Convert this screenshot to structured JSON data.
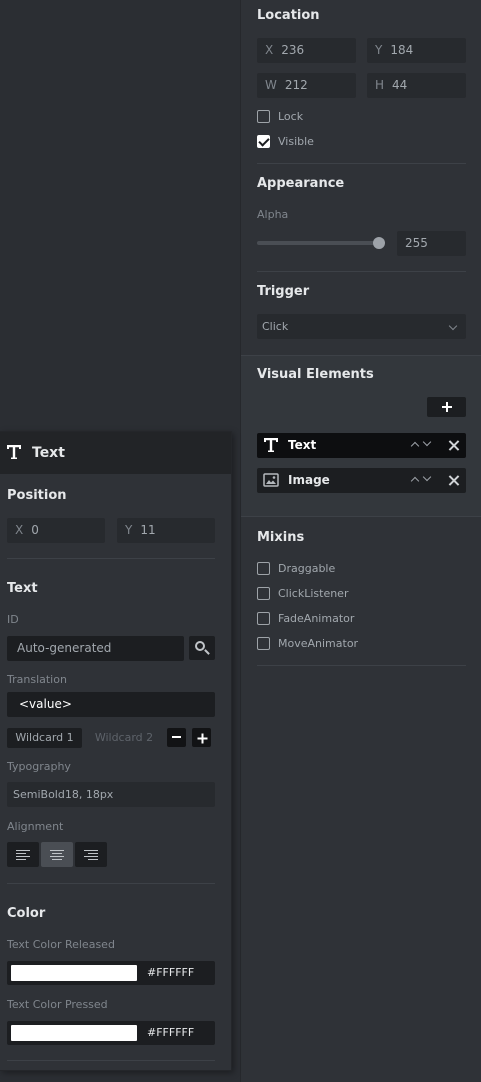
{
  "location": {
    "title": "Location",
    "x_label": "X",
    "x_value": "236",
    "y_label": "Y",
    "y_value": "184",
    "w_label": "W",
    "w_value": "212",
    "h_label": "H",
    "h_value": "44",
    "lock_label": "Lock",
    "lock_checked": false,
    "visible_label": "Visible",
    "visible_checked": true
  },
  "appearance": {
    "title": "Appearance",
    "alpha_label": "Alpha",
    "alpha_value": "255"
  },
  "trigger": {
    "title": "Trigger",
    "selected": "Click"
  },
  "visual_elements": {
    "title": "Visual Elements",
    "items": [
      {
        "label": "Text",
        "icon": "text-icon",
        "selected": true
      },
      {
        "label": "Image",
        "icon": "image-icon",
        "selected": false
      }
    ]
  },
  "mixins": {
    "title": "Mixins",
    "items": [
      {
        "label": "Draggable",
        "checked": false
      },
      {
        "label": "ClickListener",
        "checked": false
      },
      {
        "label": "FadeAnimator",
        "checked": false
      },
      {
        "label": "MoveAnimator",
        "checked": false
      }
    ]
  },
  "text_panel": {
    "header": "Text",
    "position": {
      "title": "Position",
      "x_label": "X",
      "x_value": "0",
      "y_label": "Y",
      "y_value": "11"
    },
    "text": {
      "title": "Text",
      "id_label": "ID",
      "id_placeholder": "Auto-generated",
      "translation_label": "Translation",
      "translation_value": "<value>",
      "wildcard_tabs": [
        "Wildcard 1",
        "Wildcard 2"
      ],
      "typography_label": "Typography",
      "typography_value": "SemiBold18, 18px",
      "alignment_label": "Alignment",
      "alignment_selected": "center"
    },
    "color": {
      "title": "Color",
      "released_label": "Text Color Released",
      "released_value": "#FFFFFF",
      "pressed_label": "Text Color Pressed",
      "pressed_value": "#FFFFFF"
    }
  }
}
